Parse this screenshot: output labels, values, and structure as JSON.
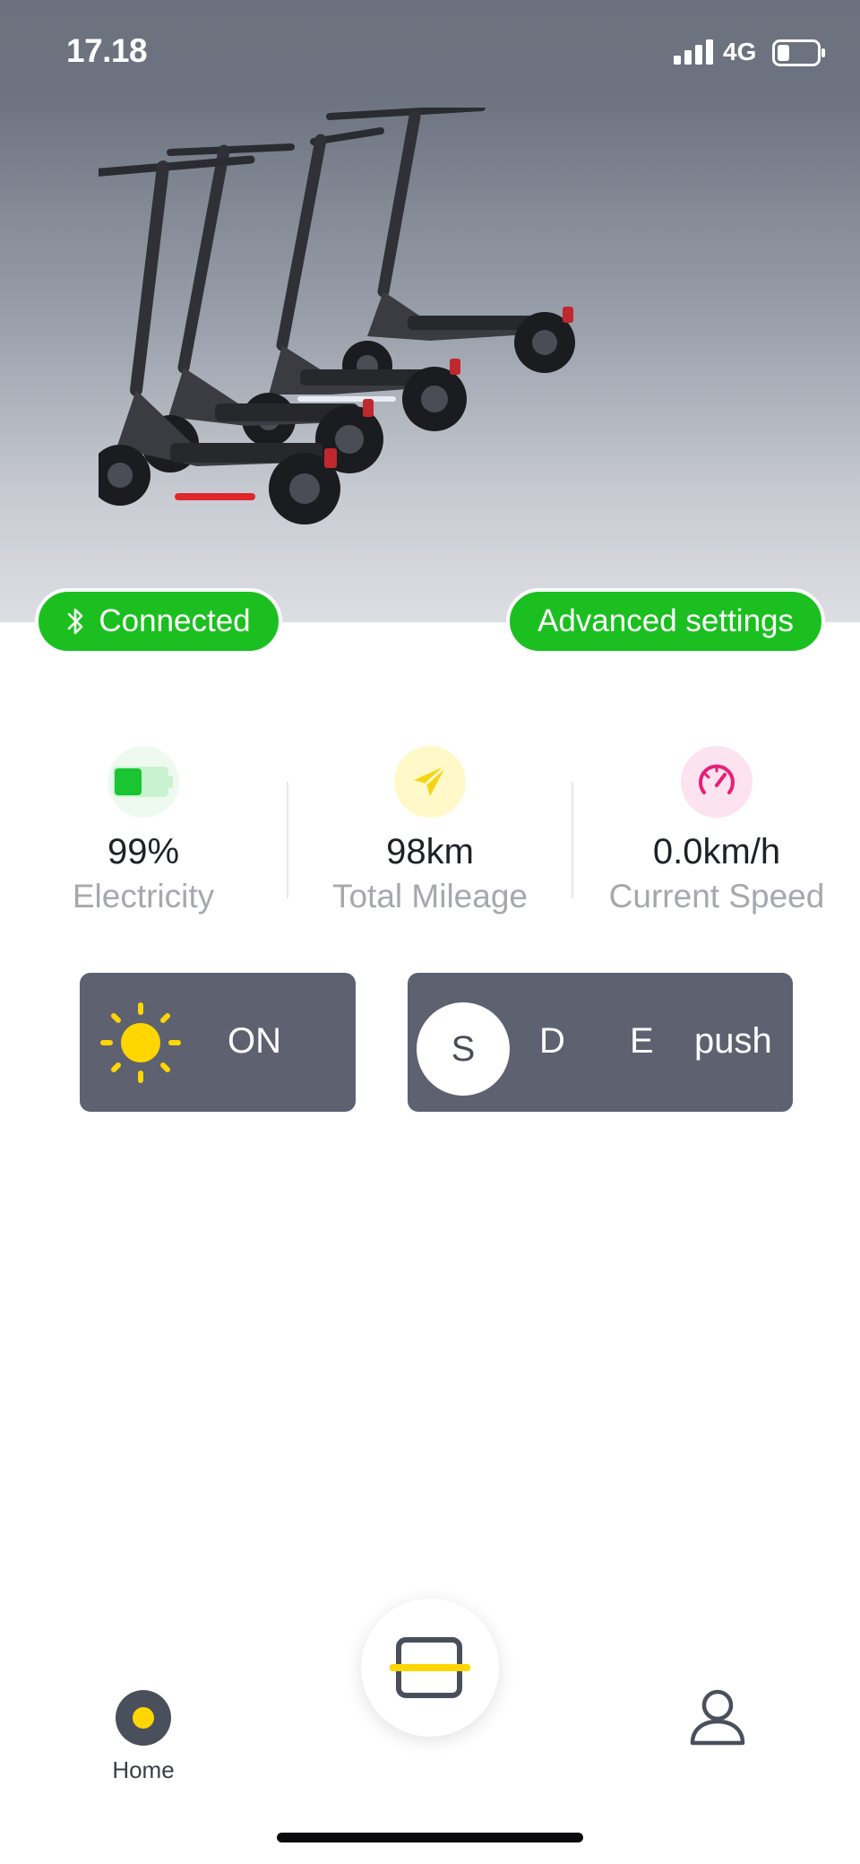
{
  "status_bar": {
    "time": "17.18",
    "network": "4G",
    "battery_icon": "battery-low-icon",
    "signal_icon": "cellular-signal-icon"
  },
  "hero": {
    "image": "electric-scooters-illustration",
    "connection_label": "Connected",
    "connection_icon": "bluetooth-icon",
    "advanced_settings_label": "Advanced settings",
    "accent_color": "#1bc020"
  },
  "stats": [
    {
      "value": "99%",
      "label": "Electricity",
      "icon": "battery-icon",
      "icon_color": "#19c530"
    },
    {
      "value": "98km",
      "label": "Total Mileage",
      "icon": "paper-plane-icon",
      "icon_color": "#f3d514"
    },
    {
      "value": "0.0km/h",
      "label": "Current Speed",
      "icon": "speedometer-icon",
      "icon_color": "#e81e78"
    }
  ],
  "light": {
    "icon": "sun-icon",
    "state": "ON"
  },
  "modes": {
    "options": [
      "S",
      "D",
      "E",
      "push"
    ],
    "selected": "S"
  },
  "nav": {
    "home_label": "Home",
    "home_icon": "home-dot-icon",
    "scan_icon": "scan-icon",
    "profile_icon": "user-profile-icon"
  }
}
